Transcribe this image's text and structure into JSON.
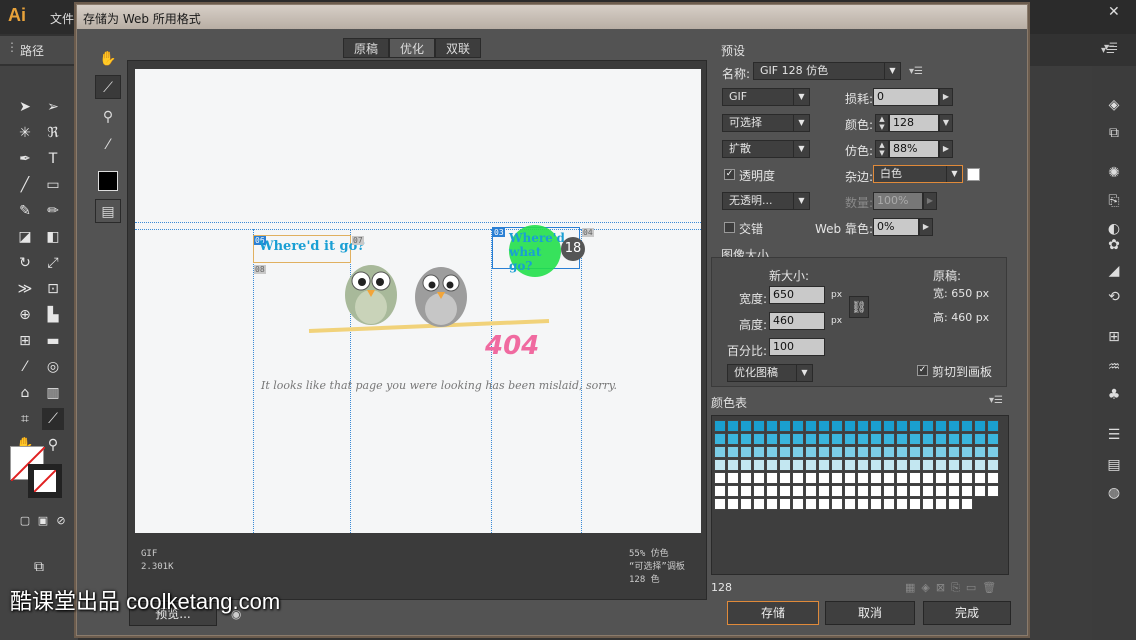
{
  "app": {
    "logo": "Ai",
    "menu_first": "文件",
    "control_label": "路径"
  },
  "dialog": {
    "title": "存储为 Web 所用格式",
    "tabs": [
      "原稿",
      "优化",
      "双联"
    ],
    "preview": {
      "slice_ids": [
        "06",
        "07",
        "08",
        "03",
        "04"
      ],
      "headline_left": "Where'd it go?",
      "headline_right": "Where'd what go?",
      "badge": "18",
      "error_code": "404",
      "message": "It looks like that page you were looking has been mislaid, sorry."
    },
    "info_left": [
      "GIF",
      "2.301K"
    ],
    "info_right": [
      "55% 仿色",
      "“可选择”调板",
      "128 色"
    ],
    "preset": {
      "section": "预设",
      "name_label": "名称:",
      "name_value": "GIF 128 仿色",
      "format": "GIF",
      "loss_label": "损耗:",
      "loss_value": "0",
      "reduction": "可选择",
      "colors_label": "颜色:",
      "colors_value": "128",
      "dither_algo": "扩散",
      "dither_label": "仿色:",
      "dither_value": "88%",
      "transparency_label": "透明度",
      "matte_label": "杂边:",
      "matte_value": "白色",
      "trans_dither": "无透明...",
      "amount_label": "数量:",
      "amount_value": "100%",
      "interlaced_label": "交错",
      "websnap_label": "Web 靠色:",
      "websnap_value": "0%"
    },
    "imagesize": {
      "section": "图像大小",
      "new_size": "新大小:",
      "width_label": "宽度:",
      "width_value": "650",
      "height_label": "高度:",
      "height_value": "460",
      "unit": "px",
      "percent_label": "百分比:",
      "percent_value": "100",
      "quality": "优化图稿",
      "original_label": "原稿:",
      "orig_w": "宽: 650 px",
      "orig_h": "高: 460 px",
      "clip_label": "剪切到画板"
    },
    "colortable": {
      "section": "颜色表",
      "count": "128"
    },
    "buttons": {
      "preview": "预览...",
      "save": "存储",
      "cancel": "取消",
      "done": "完成"
    }
  },
  "watermark": "酷课堂出品 coolketang.com",
  "colors": {
    "accent_focus": "#e08a3a",
    "slice_blue": "#2a7fd4",
    "headline": "#1a9fd4",
    "error_pink": "#f06aa0",
    "green_cursor": "#22e04a"
  }
}
